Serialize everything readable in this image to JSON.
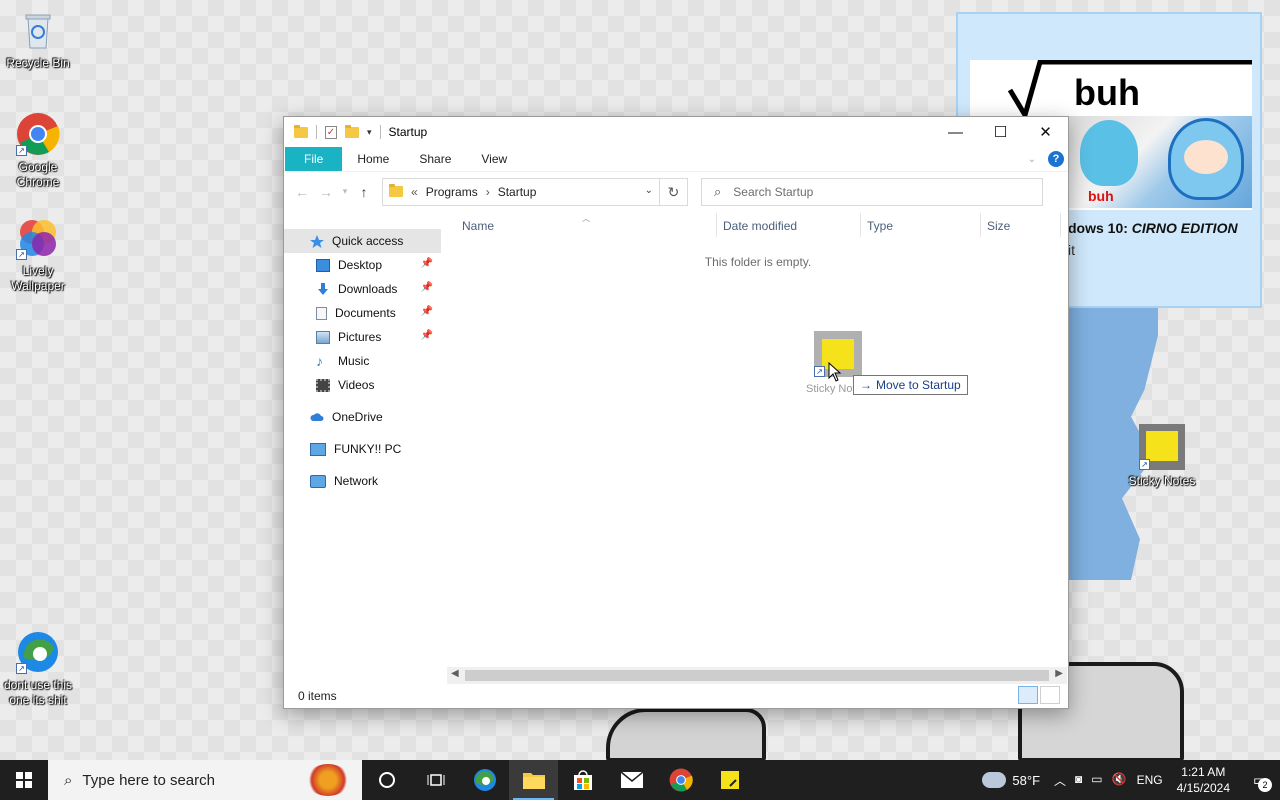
{
  "desktop": {
    "icons": [
      {
        "label": "Recycle Bin"
      },
      {
        "label": "Google Chrome"
      },
      {
        "label": "Lively Wallpaper"
      },
      {
        "label": "dont use this one its shit"
      },
      {
        "label": "Sticky Notes"
      }
    ],
    "wallpaper": {
      "meme_text": "buh",
      "meme_small_text": "buh",
      "caption_prefix": "dows 10: ",
      "caption_emphasis": "CIRNO EDITION",
      "caption_line2": "it"
    }
  },
  "explorer": {
    "title": "Startup",
    "window_controls": {
      "minimize": "—",
      "maximize": "☐",
      "close": "✕"
    },
    "ribbon_tabs": [
      "File",
      "Home",
      "Share",
      "View"
    ],
    "address": {
      "prefix": "«",
      "crumbs": [
        "Programs",
        "Startup"
      ],
      "separator": "›"
    },
    "search_placeholder": "Search Startup",
    "nav": {
      "quick_access": "Quick access",
      "pinned": [
        {
          "label": "Desktop",
          "pinned": true
        },
        {
          "label": "Downloads",
          "pinned": true
        },
        {
          "label": "Documents",
          "pinned": true
        },
        {
          "label": "Pictures",
          "pinned": true
        },
        {
          "label": "Music",
          "pinned": false
        },
        {
          "label": "Videos",
          "pinned": false
        }
      ],
      "onedrive": "OneDrive",
      "pc": "FUNKY!! PC",
      "network": "Network"
    },
    "columns": [
      "Name",
      "Date modified",
      "Type",
      "Size"
    ],
    "empty_message": "This folder is empty.",
    "status": "0 items"
  },
  "drag": {
    "item_label": "Sticky Notes",
    "tooltip": "Move to Startup"
  },
  "taskbar": {
    "search_placeholder": "Type here to search",
    "weather": "58°F",
    "language": "ENG",
    "time": "1:21 AM",
    "date": "4/15/2024",
    "notification_count": "2"
  },
  "colors": {
    "file_tab": "#19b3c4",
    "taskbar": "#1f1f1f",
    "sticky_note": "#f6e21a",
    "selected_nav": "#e5e5e5"
  }
}
